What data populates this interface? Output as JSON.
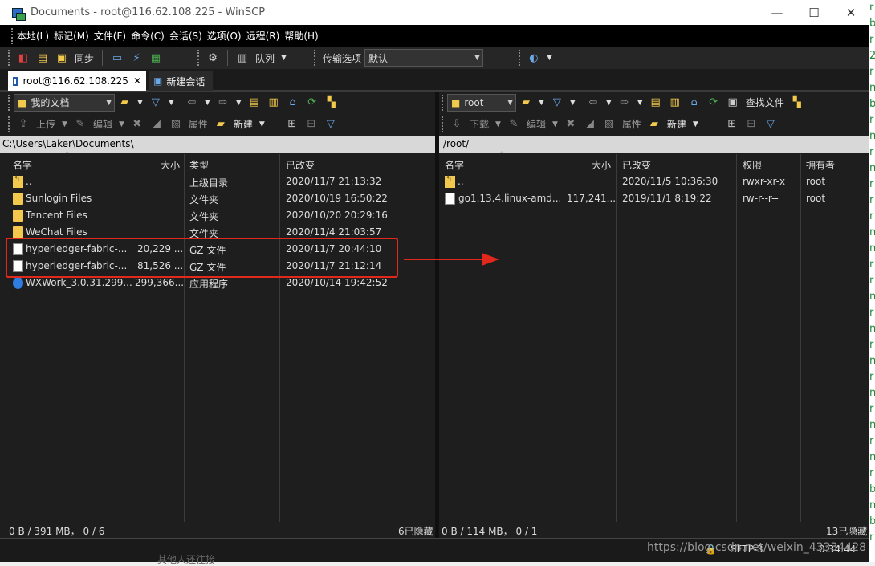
{
  "window": {
    "title": "Documents - root@116.62.108.225 - WinSCP",
    "minimize": "—",
    "maximize": "☐",
    "close": "✕"
  },
  "menu": [
    "本地(L)",
    "标记(M)",
    "文件(F)",
    "命令(C)",
    "会话(S)",
    "选项(O)",
    "远程(R)",
    "帮助(H)"
  ],
  "toolbar": {
    "sync_label": "同步",
    "queue_label": "队列",
    "transfer_options_label": "传输选项",
    "transfer_preset": "默认"
  },
  "tabs": {
    "active": "root@116.62.108.225",
    "new_session": "新建会话"
  },
  "left": {
    "location": "我的文档",
    "upload_label": "上传",
    "edit_label": "编辑",
    "properties_label": "属性",
    "new_label": "新建",
    "path": "C:\\Users\\Laker\\Documents\\",
    "columns": [
      "名字",
      "大小",
      "类型",
      "已改变"
    ],
    "rows": [
      {
        "icon": "up",
        "name": "..",
        "size": "",
        "type": "上级目录",
        "changed": "2020/11/7   21:13:32"
      },
      {
        "icon": "folder",
        "name": "Sunlogin Files",
        "size": "",
        "type": "文件夹",
        "changed": "2020/10/19  16:50:22"
      },
      {
        "icon": "folder",
        "name": "Tencent Files",
        "size": "",
        "type": "文件夹",
        "changed": "2020/10/20  20:29:16"
      },
      {
        "icon": "folder",
        "name": "WeChat Files",
        "size": "",
        "type": "文件夹",
        "changed": "2020/11/4   21:03:57"
      },
      {
        "icon": "file",
        "name": "hyperledger-fabric-...",
        "size": "20,229 ...",
        "type": "GZ 文件",
        "changed": "2020/11/7   20:44:10"
      },
      {
        "icon": "file",
        "name": "hyperledger-fabric-...",
        "size": "81,526 ...",
        "type": "GZ 文件",
        "changed": "2020/11/7   21:12:14"
      },
      {
        "icon": "exe",
        "name": "WXWork_3.0.31.299...",
        "size": "299,366...",
        "type": "应用程序",
        "changed": "2020/10/14  19:42:52"
      }
    ],
    "status_left": "0 B / 391 MB， 0 / 6",
    "status_right": "6已隐藏"
  },
  "right": {
    "location": "root",
    "download_label": "下载",
    "edit_label": "编辑",
    "properties_label": "属性",
    "new_label": "新建",
    "find_label": "查找文件",
    "path": "/root/",
    "columns": [
      "名字",
      "大小",
      "已改变",
      "权限",
      "拥有者"
    ],
    "rows": [
      {
        "icon": "up",
        "name": "..",
        "size": "",
        "changed": "2020/11/5 10:36:30",
        "rights": "rwxr-xr-x",
        "owner": "root"
      },
      {
        "icon": "file",
        "name": "go1.13.4.linux-amd...",
        "size": "117,241...",
        "changed": "2019/11/1 8:19:22",
        "rights": "rw-r--r--",
        "owner": "root"
      }
    ],
    "status_left": "0 B / 114 MB， 0 / 1",
    "status_right": "13已隐藏"
  },
  "bottom": {
    "watermark": "https://blog.csdn.net/weixin_43334428",
    "protocol": "SFTP-3",
    "time": "0:34:44",
    "underlying_text": "其他人还往接"
  },
  "colors": {
    "highlight": "#e0291c",
    "folder": "#f2c94c",
    "background": "#1e1e1e"
  }
}
